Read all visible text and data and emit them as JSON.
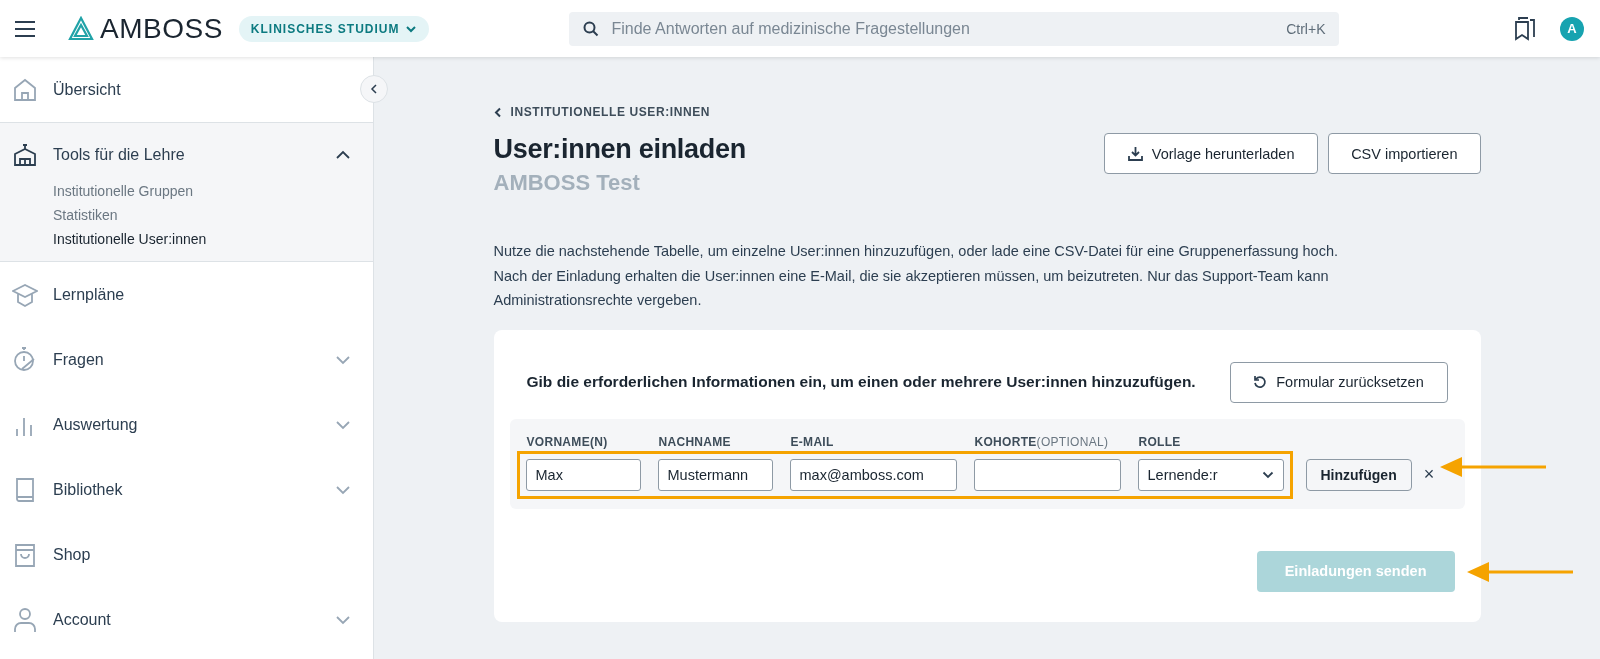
{
  "header": {
    "logo": "AMBOSS",
    "study_switch": {
      "label": "KLINISCHES STUDIUM",
      "expanded": false
    },
    "search": {
      "placeholder": "Finde Antworten auf medizinische Fragestellungen",
      "shortcut": "Ctrl+K"
    },
    "avatar": "A"
  },
  "sidebar": {
    "items": [
      {
        "label": "Übersicht",
        "kind": "link"
      },
      {
        "label": "Tools für die Lehre",
        "kind": "group",
        "expanded": true,
        "children": [
          {
            "label": "Institutionelle Gruppen",
            "selected": false
          },
          {
            "label": "Statistiken",
            "selected": false
          },
          {
            "label": "Institutionelle User:innen",
            "selected": true
          }
        ]
      },
      {
        "label": "Lernpläne",
        "kind": "link"
      },
      {
        "label": "Fragen",
        "kind": "group",
        "expanded": false
      },
      {
        "label": "Auswertung",
        "kind": "group",
        "expanded": false
      },
      {
        "label": "Bibliothek",
        "kind": "group",
        "expanded": false
      },
      {
        "label": "Shop",
        "kind": "link"
      },
      {
        "label": "Account",
        "kind": "group",
        "expanded": false
      }
    ]
  },
  "page": {
    "breadcrumb": "INSTITUTIONELLE USER:INNEN",
    "title": "User:innen einladen",
    "subtitle": "AMBOSS Test",
    "actions": [
      {
        "label": "Vorlage herunterladen",
        "kind": "download"
      },
      {
        "label": "CSV importieren",
        "kind": "plain"
      }
    ],
    "description": "Nutze die nachstehende Tabelle, um einzelne User:innen hinzuzufügen, oder lade eine CSV-Datei für eine Gruppenerfassung hoch. Nach der Einladung erhalten die User:innen eine E-Mail, die sie akzeptieren müssen, um beizutreten. Nur das Support-Team kann Administrationsrechte vergeben.",
    "form": {
      "instruction": "Gib die erforderlichen Informationen ein, um einen oder mehrere User:innen hinzuzufügen.",
      "reset_button": "Formular zurücksetzen",
      "fields": [
        {
          "label": "VORNAME(N)",
          "kind": "text",
          "value": "Max"
        },
        {
          "label": "NACHNAME",
          "kind": "text",
          "value": "Mustermann"
        },
        {
          "label": "E-MAIL",
          "kind": "text",
          "value": "max@amboss.com"
        },
        {
          "label": "KOHORTE",
          "hint": "(OPTIONAL)",
          "kind": "text"
        },
        {
          "label": "ROLLE",
          "kind": "select",
          "value": "Lernende:r"
        }
      ],
      "add_button": "Hinzufügen",
      "remove": "×",
      "send_button": {
        "label": "Einladungen senden",
        "disabled": true
      }
    }
  }
}
